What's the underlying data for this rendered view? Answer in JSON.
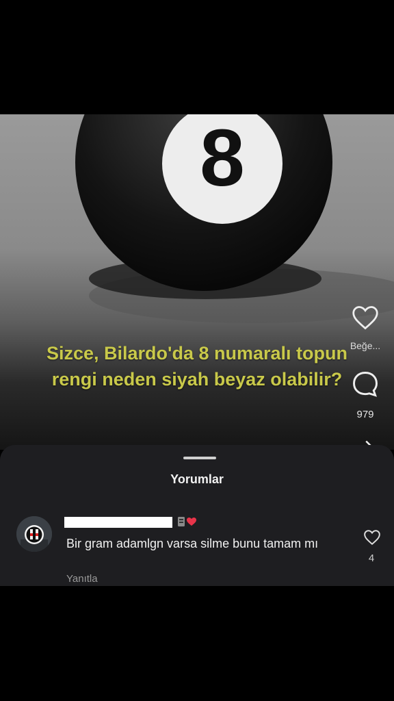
{
  "post": {
    "caption_line1": "Sizce, Bilardo'da 8 numaralı topun",
    "caption_line2": "rengi neden siyah beyaz olabilir?",
    "ball_number": "8",
    "like_label": "Beğe...",
    "comment_count": "979"
  },
  "comments_sheet": {
    "title": "Yorumlar",
    "comments": [
      {
        "text": "Bir gram adamlgn varsa silme bunu tamam mı",
        "reply_label": "Yanıtla",
        "like_count": "4"
      }
    ]
  },
  "colors": {
    "caption": "#c9c94a",
    "sheet_bg": "#1e1e21",
    "heart_badge": "#e8344a"
  }
}
